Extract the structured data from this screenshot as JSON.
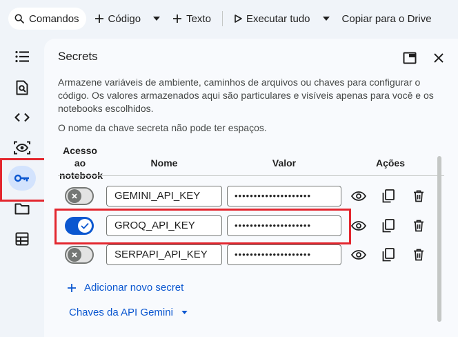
{
  "toolbar": {
    "commands_label": "Comandos",
    "code_label": "Código",
    "text_label": "Texto",
    "run_all_label": "Executar tudo",
    "copy_drive_label": "Copiar para o Drive"
  },
  "panel": {
    "title": "Secrets",
    "description": "Armazene variáveis de ambiente, caminhos de arquivos ou chaves para configurar o código. Os valores armazenados aqui são particulares e visíveis apenas para você e os notebooks escolhidos.",
    "note": "O nome da chave secreta não pode ter espaços.",
    "columns": {
      "access": "Acesso ao notebook",
      "name": "Nome",
      "value": "Valor",
      "actions": "Ações"
    },
    "secrets": [
      {
        "name": "GEMINI_API_KEY",
        "value": "••••••••••••••••••••",
        "access": false
      },
      {
        "name": "GROQ_API_KEY",
        "value": "••••••••••••••••••••",
        "access": true
      },
      {
        "name": "SERPAPI_API_KEY",
        "value": "••••••••••••••••••••",
        "access": false
      }
    ],
    "add_secret_label": "Adicionar novo secret",
    "gemini_keys_label": "Chaves da API Gemini"
  },
  "colors": {
    "accent": "#0b57d0",
    "highlight": "#e3262e",
    "rail_active": "#d3e3fd"
  }
}
